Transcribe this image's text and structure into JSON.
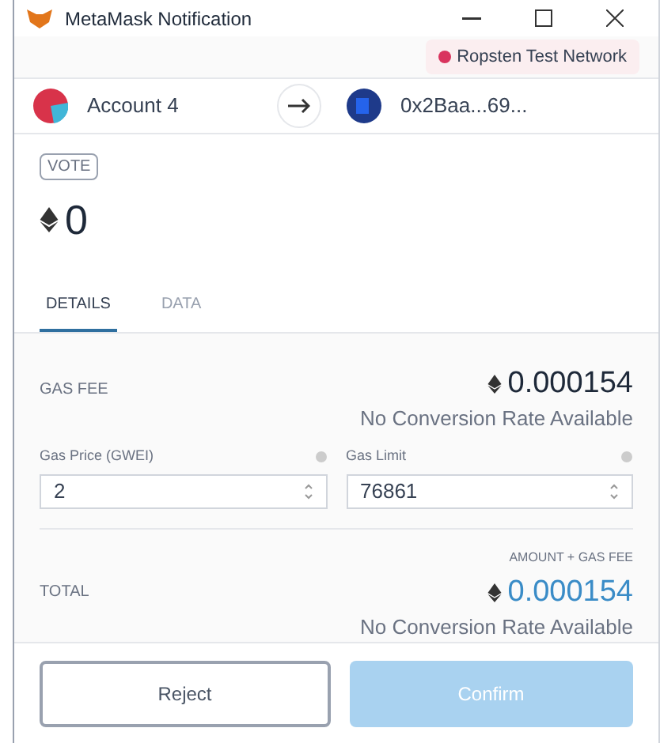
{
  "window": {
    "title": "MetaMask Notification"
  },
  "network": {
    "label": "Ropsten Test Network",
    "color": "#d9345e"
  },
  "from_account": {
    "name": "Account 4"
  },
  "to_account": {
    "address": "0x2Baa...69..."
  },
  "method_badge": "VOTE",
  "amount": "0",
  "tabs": [
    {
      "label": "DETAILS",
      "selected": true
    },
    {
      "label": "DATA",
      "selected": false
    }
  ],
  "gas_fee": {
    "label": "GAS FEE",
    "amount": "0.000154",
    "conversion": "No Conversion Rate Available"
  },
  "fields": [
    {
      "label": "Gas Price (GWEI)",
      "value": "2"
    },
    {
      "label": "Gas Limit",
      "value": "76861"
    }
  ],
  "total": {
    "caption": "AMOUNT + GAS FEE",
    "label": "TOTAL",
    "amount": "0.000154",
    "conversion": "No Conversion Rate Available"
  },
  "buttons": [
    {
      "label": "Reject",
      "kind": "secondary",
      "disabled": false
    },
    {
      "label": "Confirm",
      "kind": "primary",
      "disabled": true
    }
  ]
}
